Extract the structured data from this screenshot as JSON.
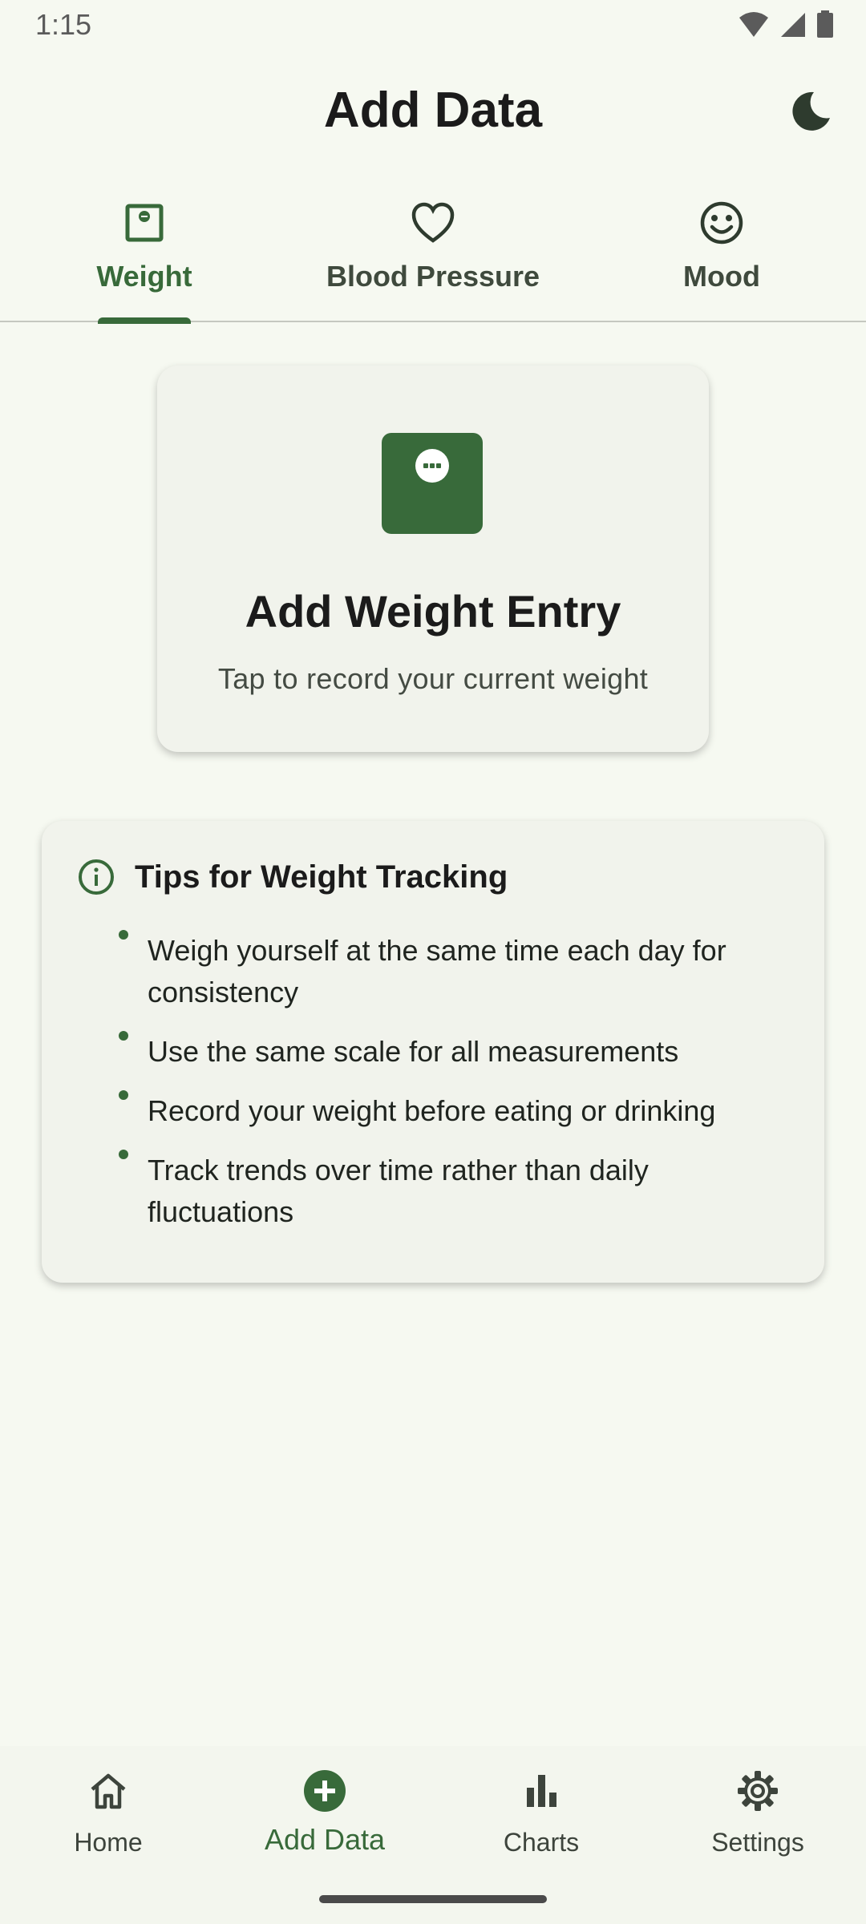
{
  "status_bar": {
    "time": "1:15",
    "icons": [
      "wifi-icon",
      "cell-signal-icon",
      "battery-icon"
    ]
  },
  "app_bar": {
    "title": "Add Data",
    "theme_toggle_icon": "moon-icon"
  },
  "tabs": [
    {
      "label": "Weight",
      "icon": "scale-icon",
      "active": true
    },
    {
      "label": "Blood Pressure",
      "icon": "heart-outline-icon",
      "active": false
    },
    {
      "label": "Mood",
      "icon": "smile-icon",
      "active": false
    }
  ],
  "add_entry_card": {
    "icon": "scale-icon",
    "title": "Add Weight Entry",
    "subtitle": "Tap to record your current weight"
  },
  "tips_card": {
    "icon": "info-icon",
    "title": "Tips for Weight Tracking",
    "items": [
      "Weigh yourself at the same time each day for consistency",
      "Use the same scale for all measurements",
      "Record your weight before eating or drinking",
      "Track trends over time rather than daily fluctuations"
    ]
  },
  "bottom_nav": [
    {
      "label": "Home",
      "icon": "home-icon",
      "active": false
    },
    {
      "label": "Add Data",
      "icon": "add-circle-icon",
      "active": true
    },
    {
      "label": "Charts",
      "icon": "bar-chart-icon",
      "active": false
    },
    {
      "label": "Settings",
      "icon": "gear-icon",
      "active": false
    }
  ],
  "colors": {
    "primary": "#386a3a",
    "background": "#f6f9f1",
    "card": "#f1f3ec"
  }
}
